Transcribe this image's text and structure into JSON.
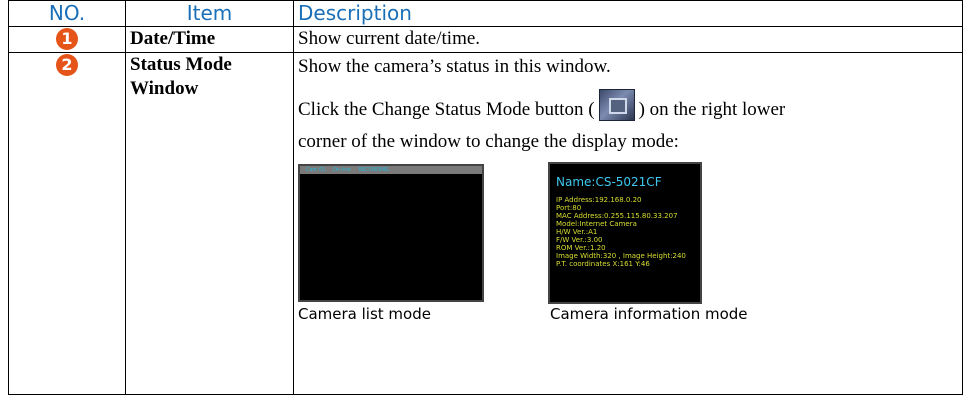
{
  "header": {
    "no": "NO.",
    "item": "Item",
    "description": "Description"
  },
  "colors": {
    "header_text": "#1a6fb7",
    "badge": "#e55418"
  },
  "rows": [
    {
      "badge": "1",
      "item": "Date/Time",
      "description": "Show current date/time."
    },
    {
      "badge": "2",
      "item_line1": "Status Mode",
      "item_line2": "Window",
      "description_line1": "Show the camera’s status in this window.",
      "description_line2_before": "Click the Change Status Mode button (",
      "description_line2_after": ") on the right lower",
      "description_line3": "corner of the window to change the display mode:",
      "button_icon": "change-status-mode-button-icon",
      "shot1": {
        "bar_fields": [
          "Cam 01",
          "On-line",
          "RECORDING"
        ],
        "caption": "Camera list mode"
      },
      "shot2": {
        "name": "Name:CS-5021CF",
        "info": [
          "IP Address:192.168.0.20",
          "Port:80",
          "MAC Address:0.255.115.80.33.207",
          "Model:Internet Camera",
          "H/W Ver.:A1",
          "F/W Ver.:3.00",
          "ROM Ver.:1.20",
          "Image Width:320 , Image Height:240",
          "P.T. coordinates X:161   Y:46"
        ],
        "caption": "Camera information mode"
      }
    }
  ]
}
